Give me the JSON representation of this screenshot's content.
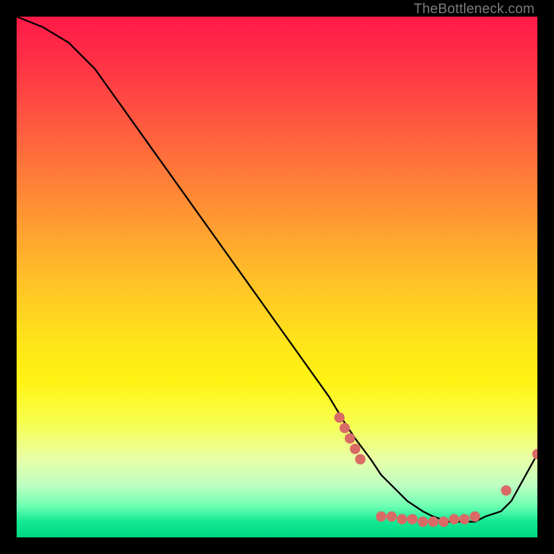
{
  "watermark": "TheBottleneck.com",
  "chart_data": {
    "type": "line",
    "title": "",
    "xlabel": "",
    "ylabel": "",
    "xlim": [
      0,
      100
    ],
    "ylim": [
      0,
      100
    ],
    "grid": false,
    "legend": false,
    "series": [
      {
        "name": "curve",
        "color": "#000000",
        "x": [
          0,
          5,
          10,
          15,
          20,
          25,
          30,
          35,
          40,
          45,
          50,
          55,
          60,
          63,
          65,
          68,
          70,
          73,
          75,
          78,
          80,
          83,
          85,
          88,
          90,
          93,
          95,
          100
        ],
        "y": [
          100,
          98,
          95,
          90,
          83,
          76,
          69,
          62,
          55,
          48,
          41,
          34,
          27,
          22,
          19,
          15,
          12,
          9,
          7,
          5,
          4,
          3,
          3,
          3,
          4,
          5,
          7,
          16
        ]
      }
    ],
    "markers": [
      {
        "name": "dots",
        "color": "#d96a66",
        "radius_pct": 1.0,
        "points": [
          {
            "x": 62,
            "y": 23
          },
          {
            "x": 63,
            "y": 21
          },
          {
            "x": 64,
            "y": 19
          },
          {
            "x": 65,
            "y": 17
          },
          {
            "x": 66,
            "y": 15
          },
          {
            "x": 70,
            "y": 4
          },
          {
            "x": 72,
            "y": 4
          },
          {
            "x": 74,
            "y": 3.5
          },
          {
            "x": 76,
            "y": 3.5
          },
          {
            "x": 78,
            "y": 3
          },
          {
            "x": 80,
            "y": 3
          },
          {
            "x": 82,
            "y": 3
          },
          {
            "x": 84,
            "y": 3.5
          },
          {
            "x": 86,
            "y": 3.5
          },
          {
            "x": 88,
            "y": 4
          },
          {
            "x": 94,
            "y": 9
          },
          {
            "x": 100,
            "y": 16
          }
        ]
      }
    ]
  }
}
